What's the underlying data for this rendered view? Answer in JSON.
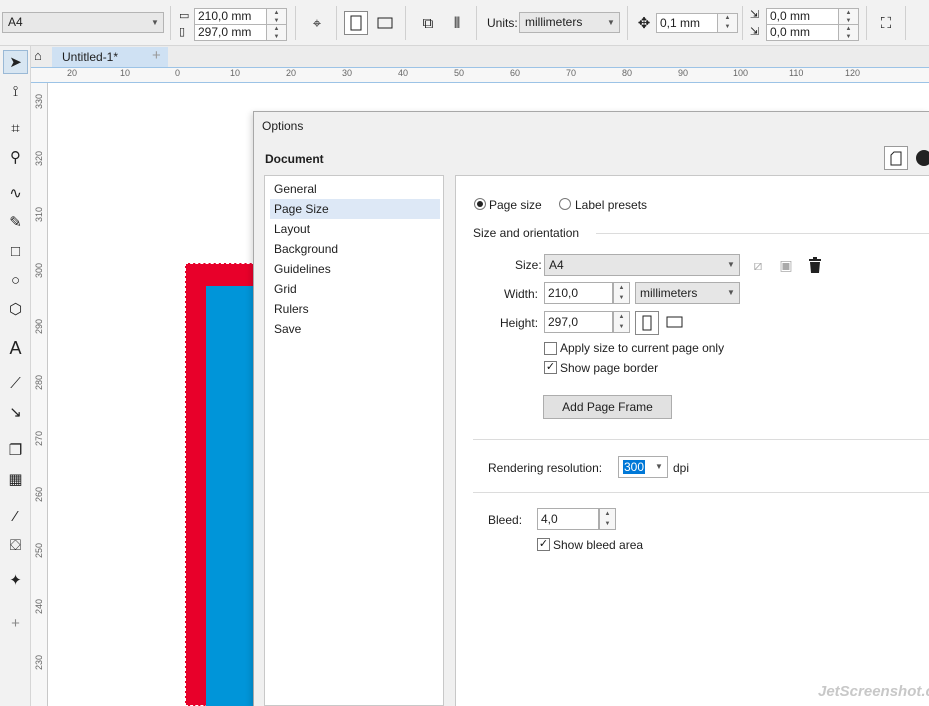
{
  "propbar": {
    "page_preset": "A4",
    "width": "210,0 mm",
    "height": "297,0 mm",
    "units_label": "Units:",
    "units_value": "millimeters",
    "nudge": "0,1 mm",
    "dup_x": "0,0 mm",
    "dup_y": "0,0 mm"
  },
  "tabs": {
    "doc_tab": "Untitled-1*",
    "add": "+"
  },
  "ruler": {
    "h_labels": [
      "20",
      "10",
      "0",
      "10",
      "20",
      "30",
      "40",
      "50",
      "60",
      "70",
      "80",
      "90",
      "100",
      "110",
      "120"
    ],
    "v_labels": [
      "330",
      "320",
      "310",
      "300",
      "290",
      "280",
      "270",
      "260",
      "250",
      "240",
      "230"
    ]
  },
  "dialog": {
    "title": "Options",
    "section": "Document",
    "nav": [
      "General",
      "Page Size",
      "Layout",
      "Background",
      "Guidelines",
      "Grid",
      "Rulers",
      "Save"
    ],
    "selected_nav": "Page Size",
    "radio_page_size": "Page size",
    "radio_label_presets": "Label presets",
    "group_title": "Size and orientation",
    "size_label": "Size:",
    "size_value": "A4",
    "width_label": "Width:",
    "width_value": "210,0",
    "units_value": "millimeters",
    "height_label": "Height:",
    "height_value": "297,0",
    "apply_current_only": "Apply size to current page only",
    "show_page_border": "Show page border",
    "add_page_frame": "Add Page Frame",
    "rendering_label": "Rendering resolution:",
    "rendering_value": "300",
    "dpi": "dpi",
    "bleed_label": "Bleed:",
    "bleed_value": "4,0",
    "show_bleed_area": "Show bleed area"
  },
  "watermark": "JetScreenshot.com",
  "colors": {
    "accent": "#0078d7",
    "page_red": "#e8002a",
    "page_blue": "#0095d9"
  }
}
